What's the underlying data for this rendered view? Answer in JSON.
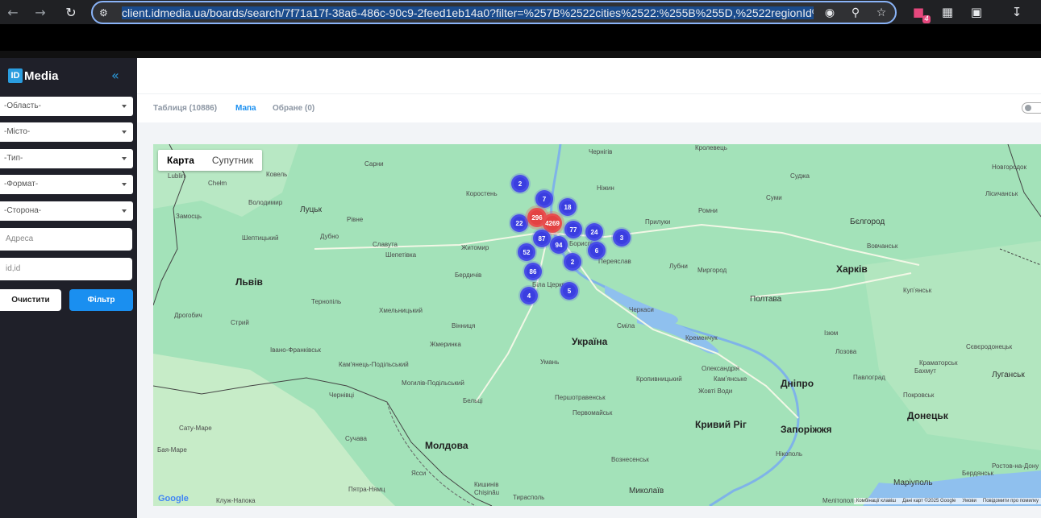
{
  "browser": {
    "url": "client.idmedia.ua/boards/search/7f71a17f-38a6-486c-90c9-2feed1eb14a0?filter=%257B%2522cities%2522:%255B%255D,%2522regionId%2",
    "extension_badge": "4"
  },
  "sidebar": {
    "logo_mark": "ID",
    "logo_text": "Media",
    "selects": [
      "-Область-",
      "-Місто-",
      "-Тип-",
      "-Формат-",
      "-Сторона-"
    ],
    "address_placeholder": "Адресa",
    "id_placeholder": "id,id",
    "clear_label": "Очистити",
    "filter_label": "Фільтр"
  },
  "tabs": {
    "table": "Таблиця (10886)",
    "map": "Мапа",
    "favorites": "Обране (0)"
  },
  "map": {
    "type_map": "Карта",
    "type_satellite": "Супутник",
    "attribution": [
      "Комбінації клавіш",
      "Дані карт ©2025 Google",
      "Умови",
      "Повідомити про помилку"
    ],
    "google": "Google",
    "clusters": [
      {
        "count": "2",
        "color": "#3a3ee0"
      },
      {
        "count": "7",
        "color": "#3a3ee0"
      },
      {
        "count": "18",
        "color": "#3a3ee0"
      },
      {
        "count": "22",
        "color": "#3a3ee0"
      },
      {
        "count": "296",
        "color": "#e34242"
      },
      {
        "count": "4269",
        "color": "#e34242"
      },
      {
        "count": "77",
        "color": "#3a3ee0"
      },
      {
        "count": "24",
        "color": "#3a3ee0"
      },
      {
        "count": "3",
        "color": "#3a3ee0"
      },
      {
        "count": "87",
        "color": "#3a3ee0"
      },
      {
        "count": "94",
        "color": "#3a3ee0"
      },
      {
        "count": "52",
        "color": "#3a3ee0"
      },
      {
        "count": "6",
        "color": "#3a3ee0"
      },
      {
        "count": "2",
        "color": "#3a3ee0"
      },
      {
        "count": "86",
        "color": "#3a3ee0"
      },
      {
        "count": "4",
        "color": "#3a3ee0"
      },
      {
        "count": "5",
        "color": "#3a3ee0"
      }
    ],
    "labels": [
      "Lublin",
      "Ковель",
      "Сарни",
      "Коростень",
      "Чернігів",
      "Кролевець",
      "Суджа",
      "Новгородок",
      "Chełm",
      "Володимир",
      "Луцьк",
      "Рівне",
      "Ніжин",
      "Суми",
      "Лісичанськ",
      "Замосць",
      "Шепетівка",
      "Житомир",
      "Прилуки",
      "Ромни",
      "Бєлгород",
      "Дубно",
      "Славута",
      "Шептицький",
      "Бердичів",
      "Біла Церква",
      "Бориспіль",
      "Переяслав",
      "Лубни",
      "Миргород",
      "Харків",
      "Вовчанськ",
      "Львів",
      "Тернопіль",
      "Хмельницький",
      "Черкаси",
      "Полтава",
      "Купʼянськ",
      "Дрогобич",
      "Стрий",
      "Вінниця",
      "Сміла",
      "Україна",
      "Кременчук",
      "Лозова",
      "Ізюм",
      "Івано-Франківськ",
      "Жмеринка",
      "Умань",
      "Олександрія",
      "Камʼянське",
      "Краматорськ",
      "Сєвєродонецьк",
      "Луганськ",
      "Кам'янець-Подільський",
      "Кропивницький",
      "Дніпро",
      "Павлоград",
      "Бахмут",
      "Чернівці",
      "Могилів-Подільський",
      "Жовті Води",
      "Покровськ",
      "Першотравенськ",
      "Кривий Ріг",
      "Запоріжжя",
      "Донецьк",
      "Бельці",
      "Первомайськ",
      "Нікополь",
      "Молдова",
      "Сату-Маре",
      "Бая-Маре",
      "Сучава",
      "Вознесенськ",
      "Маріуполь",
      "Кишинів",
      "Chișinău",
      "Ясси",
      "Тирасполь",
      "Миколаїв",
      "Мелітополь",
      "Бердянськ",
      "Ростов-на-Дону",
      "Клуж-Напока",
      "Пятра-Нямц"
    ]
  }
}
